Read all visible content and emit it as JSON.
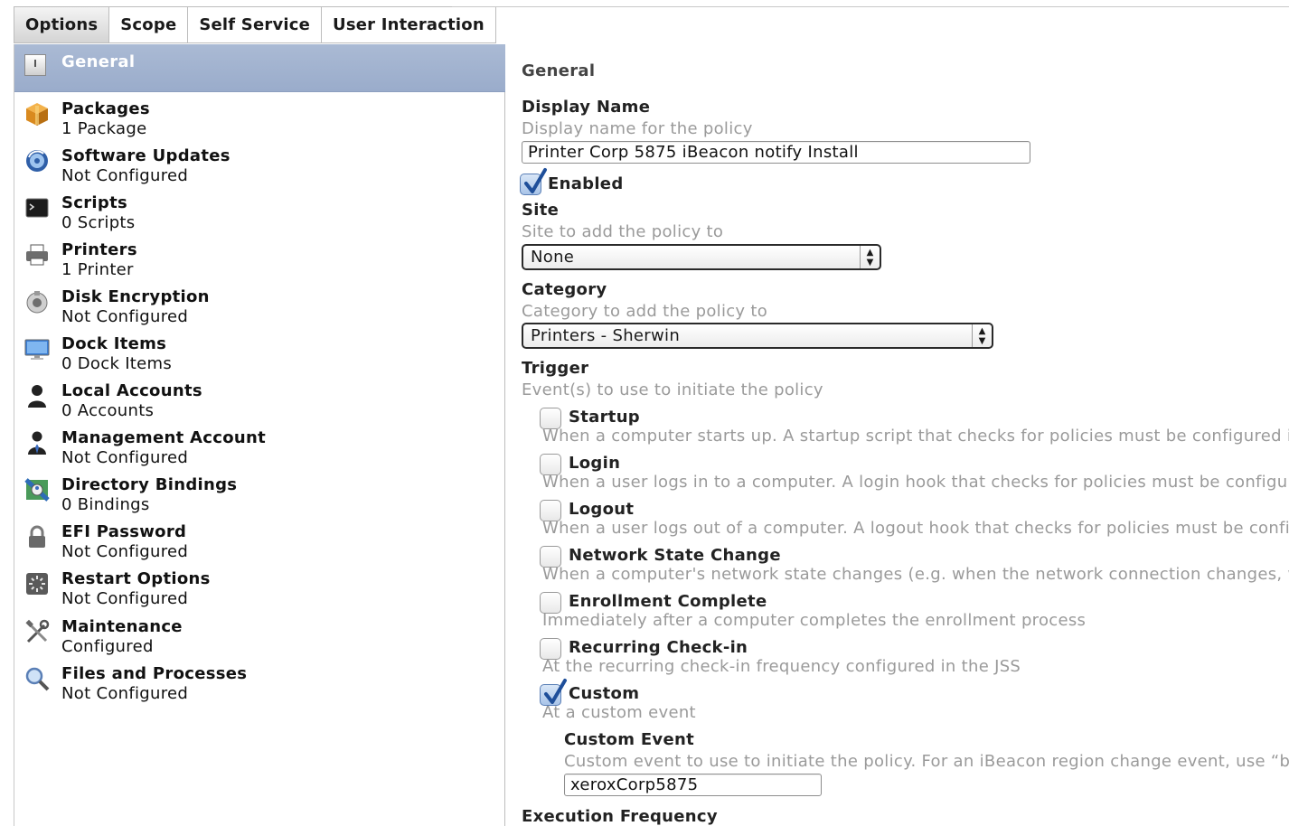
{
  "tabs": [
    "Options",
    "Scope",
    "Self Service",
    "User Interaction"
  ],
  "active_tab": "Options",
  "sidebar": {
    "selected": "General",
    "items": [
      {
        "title": "Packages",
        "sub": "1 Package",
        "icon": "package-icon"
      },
      {
        "title": "Software Updates",
        "sub": "Not Configured",
        "icon": "software-update-icon"
      },
      {
        "title": "Scripts",
        "sub": "0 Scripts",
        "icon": "terminal-icon"
      },
      {
        "title": "Printers",
        "sub": "1 Printer",
        "icon": "printer-icon"
      },
      {
        "title": "Disk Encryption",
        "sub": "Not Configured",
        "icon": "disk-encryption-icon"
      },
      {
        "title": "Dock Items",
        "sub": "0 Dock Items",
        "icon": "monitor-icon"
      },
      {
        "title": "Local Accounts",
        "sub": "0 Accounts",
        "icon": "user-silhouette-icon"
      },
      {
        "title": "Management Account",
        "sub": "Not Configured",
        "icon": "manager-icon"
      },
      {
        "title": "Directory Bindings",
        "sub": "0 Bindings",
        "icon": "directory-icon"
      },
      {
        "title": "EFI Password",
        "sub": "Not Configured",
        "icon": "lock-icon"
      },
      {
        "title": "Restart Options",
        "sub": "Not Configured",
        "icon": "restart-icon"
      },
      {
        "title": "Maintenance",
        "sub": "Configured",
        "icon": "tools-icon"
      },
      {
        "title": "Files and Processes",
        "sub": "Not Configured",
        "icon": "magnifier-icon"
      }
    ]
  },
  "general": {
    "section_title": "General",
    "display_name": {
      "label": "Display Name",
      "description": "Display name for the policy",
      "value": "Printer Corp 5875 iBeacon notify Install"
    },
    "enabled": {
      "label": "Enabled",
      "checked": true
    },
    "site": {
      "label": "Site",
      "description": "Site to add the policy to",
      "value": "None"
    },
    "category": {
      "label": "Category",
      "description": "Category to add the policy to",
      "value": "Printers - Sherwin"
    },
    "trigger": {
      "label": "Trigger",
      "description": "Event(s) to use to initiate the policy",
      "options": [
        {
          "label": "Startup",
          "description": "When a computer starts up. A startup script that checks for policies must be configured in the",
          "checked": false
        },
        {
          "label": "Login",
          "description": "When a user logs in to a computer. A login hook that checks for policies must be configured in",
          "checked": false
        },
        {
          "label": "Logout",
          "description": "When a user logs out of a computer. A logout hook that checks for policies must be configured",
          "checked": false
        },
        {
          "label": "Network State Change",
          "description": "When a computer's network state changes (e.g. when the network connection changes, when th",
          "checked": false
        },
        {
          "label": "Enrollment Complete",
          "description": "Immediately after a computer completes the enrollment process",
          "checked": false
        },
        {
          "label": "Recurring Check-in",
          "description": "At the recurring check-in frequency configured in the JSS",
          "checked": false
        },
        {
          "label": "Custom",
          "description": "At a custom event",
          "checked": true
        }
      ]
    },
    "custom_event": {
      "label": "Custom Event",
      "description": "Custom event to use to initiate the policy. For an iBeacon region change event, use “beaconS",
      "value": "xeroxCorp5875"
    },
    "execution_frequency": {
      "label": "Execution Frequency"
    }
  },
  "colors": {
    "selected_row": "#9fb1cf",
    "check_blue": "#1f4f9a",
    "muted_text": "#9a9a9a"
  }
}
